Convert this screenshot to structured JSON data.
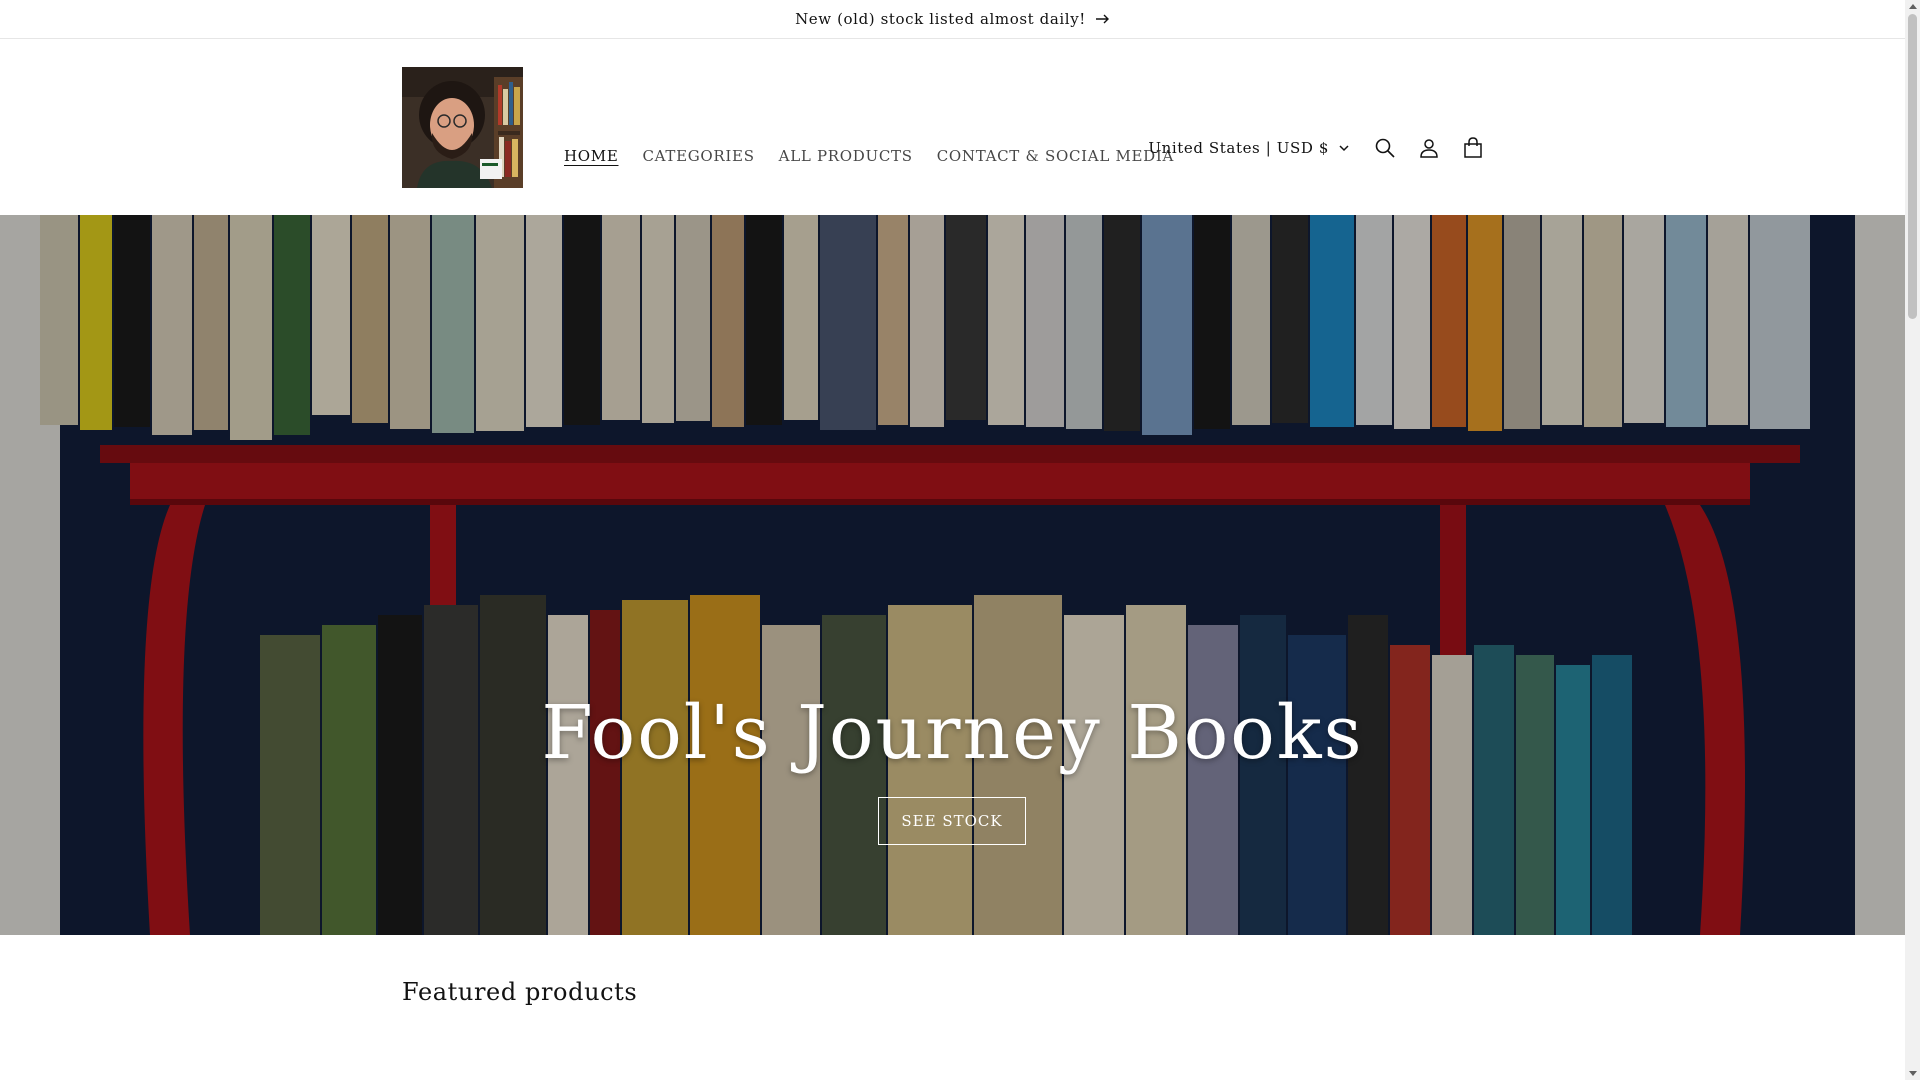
{
  "announcement": {
    "text": "New (old) stock listed almost daily!",
    "arrow_icon": "arrow-right-icon"
  },
  "header": {
    "logo_alt": "store-logo-portrait",
    "nav": [
      {
        "label": "HOME",
        "active": true
      },
      {
        "label": "CATEGORIES",
        "active": false
      },
      {
        "label": "ALL PRODUCTS",
        "active": false
      },
      {
        "label": "CONTACT & SOCIAL MEDIA",
        "active": false
      }
    ],
    "locale": "United States | USD $",
    "icons": [
      "search-icon",
      "account-icon",
      "cart-icon"
    ]
  },
  "hero": {
    "title": "Fool's Journey Books",
    "button_label": "SEE STOCK"
  },
  "featured": {
    "title": "Featured products"
  },
  "colors": {
    "text": "#121212",
    "shelf_red": "#b3141c",
    "wall_blue": "#14213d"
  }
}
